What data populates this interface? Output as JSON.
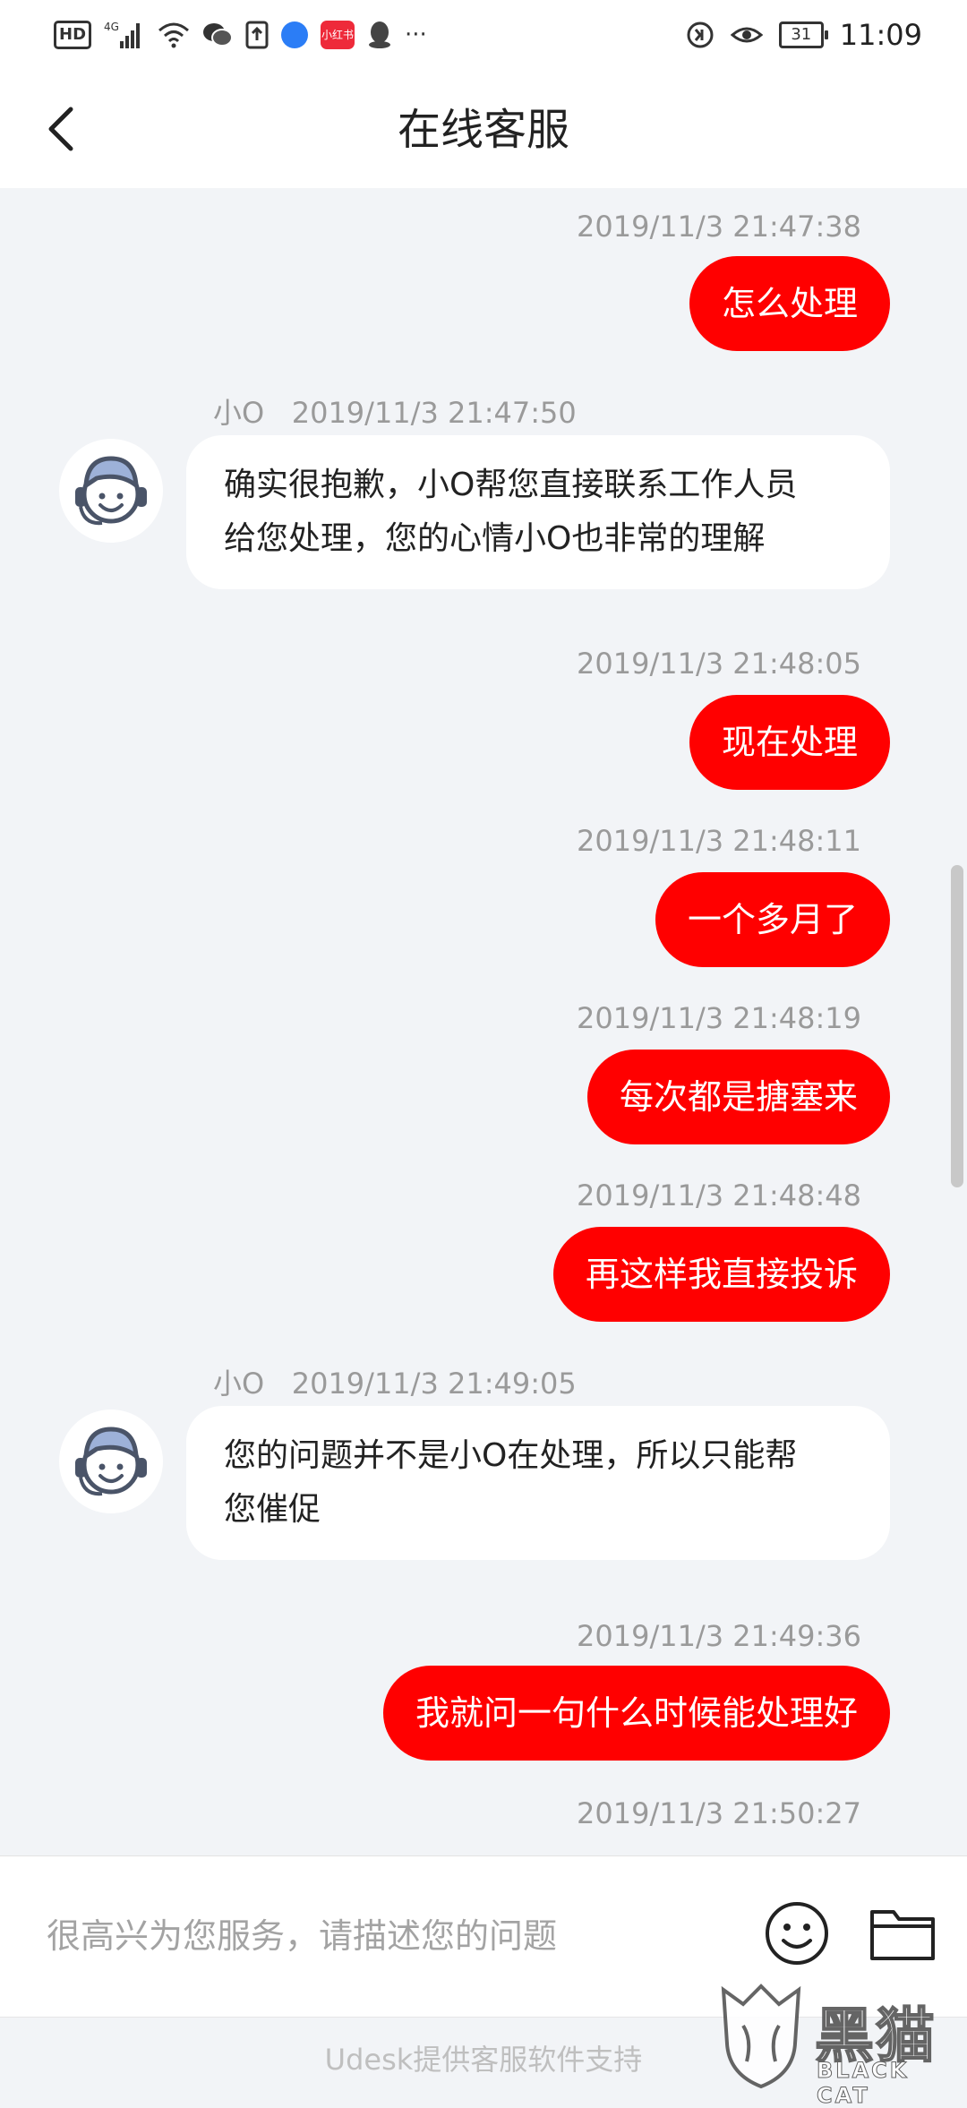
{
  "status_bar": {
    "hd": "HD",
    "signal": "4G",
    "app_badge": "小红书",
    "more": "···",
    "battery": "31",
    "time": "11:09"
  },
  "header": {
    "title": "在线客服"
  },
  "messages": [
    {
      "side": "out",
      "time": "2019/11/3 21:47:38",
      "text": "怎么处理"
    },
    {
      "side": "in",
      "sender": "小O",
      "time": "2019/11/3 21:47:50",
      "lines": [
        "确实很抱歉，小O帮您直接联系工作人员",
        "给您处理，您的心情小O也非常的理解"
      ]
    },
    {
      "side": "out",
      "time": "2019/11/3 21:48:05",
      "text": "现在处理"
    },
    {
      "side": "out",
      "time": "2019/11/3 21:48:11",
      "text": "一个多月了"
    },
    {
      "side": "out",
      "time": "2019/11/3 21:48:19",
      "text": "每次都是搪塞来"
    },
    {
      "side": "out",
      "time": "2019/11/3 21:48:48",
      "text": "再这样我直接投诉"
    },
    {
      "side": "in",
      "sender": "小O",
      "time": "2019/11/3 21:49:05",
      "lines": [
        "您的问题并不是小O在处理，所以只能帮",
        "您催促"
      ]
    },
    {
      "side": "out",
      "time": "2019/11/3 21:49:36",
      "text": "我就问一句什么时候能处理好"
    },
    {
      "side": "out",
      "time": "2019/11/3 21:50:27",
      "text": ""
    }
  ],
  "input": {
    "placeholder": "很高兴为您服务，请描述您的问题"
  },
  "footer": {
    "text": "Udesk提供客服软件支持"
  },
  "watermark": {
    "main": "黑猫",
    "sub": "BLACK CAT"
  },
  "colors": {
    "accent": "#ff0000",
    "background": "#f2f4f7"
  },
  "icons": [
    "back-arrow-icon",
    "agent-avatar-icon",
    "emoji-icon",
    "folder-icon"
  ]
}
